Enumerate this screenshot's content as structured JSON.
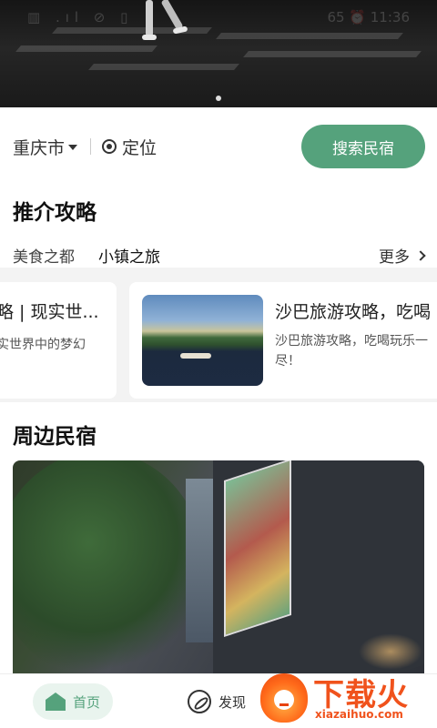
{
  "status_bar": {
    "left": "▥ .ıl ⊘ ▯",
    "right": "65  ⏰ 11:36"
  },
  "banner": {
    "page_count": 1,
    "active_index": 0
  },
  "location": {
    "city": "重庆市",
    "locate_label": "定位",
    "search_label": "搜索民宿"
  },
  "guides": {
    "title": "推介攻略",
    "tabs": [
      {
        "label": "美食之都"
      },
      {
        "label": "小镇之旅"
      }
    ],
    "active_tab": 1,
    "more_label": "更多",
    "cards": [
      {
        "title": "略 | 现实世...",
        "desc": "实世界中的梦幻"
      },
      {
        "title": "沙巴旅游攻略，吃喝",
        "desc_line1": "沙巴旅游攻略，吃喝玩乐一",
        "desc_line2": "尽！"
      }
    ]
  },
  "nearby": {
    "title": "周边民宿"
  },
  "nav": {
    "home_label": "首页",
    "discover_label": "发现"
  },
  "watermark": {
    "title": "下载火",
    "url": "xiazaihuo.com"
  },
  "colors": {
    "accent": "#55a27c",
    "accent_light": "#e9f4ee",
    "watermark": "#f0521c"
  }
}
